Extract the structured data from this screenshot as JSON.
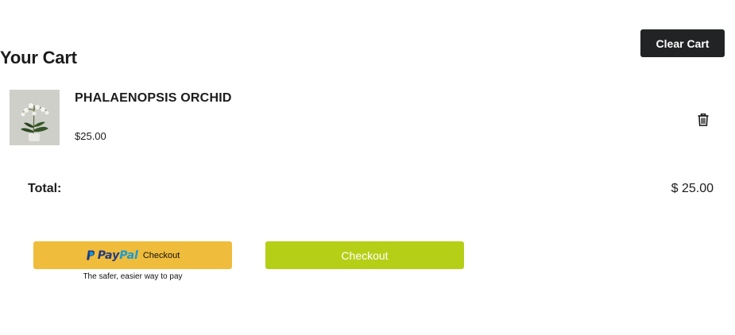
{
  "header": {
    "clear_cart_label": "Clear Cart",
    "title": "Your Cart"
  },
  "cart": {
    "items": [
      {
        "name": "PHALAENOPSIS ORCHID",
        "price": "$25.00",
        "image_icon": "orchid-photo",
        "remove_icon": "trash-icon"
      }
    ],
    "total_label": "Total:",
    "total_value": "$ 25.00"
  },
  "payment": {
    "paypal": {
      "logo_pay": "Pay",
      "logo_pal": "Pal",
      "label": "Checkout",
      "tagline": "The safer, easier way to pay",
      "color": "#f0bc3b"
    },
    "checkout_label": "Checkout",
    "checkout_color": "#b5cf17"
  },
  "colors": {
    "dark_button": "#222324",
    "text": "#1c1c1c"
  }
}
